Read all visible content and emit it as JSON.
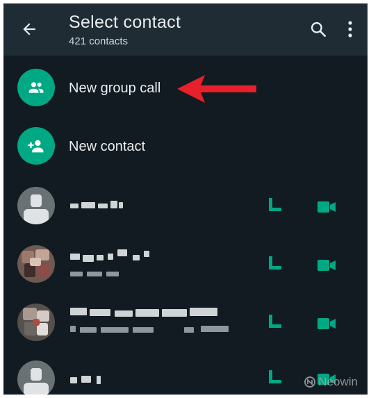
{
  "header": {
    "title": "Select contact",
    "subtitle": "421 contacts"
  },
  "actions": [
    {
      "label": "New group call",
      "icon": "group-icon"
    },
    {
      "label": "New contact",
      "icon": "add-person-icon"
    }
  ],
  "contacts": [
    {
      "label": "",
      "avatar": "default-avatar-icon"
    },
    {
      "label": "",
      "avatar": "photo"
    },
    {
      "label": "",
      "avatar": "photo"
    },
    {
      "label": "",
      "avatar": "default-avatar-icon"
    }
  ],
  "watermark": "Neowin",
  "colors": {
    "background": "#121b22",
    "header": "#1f2c34",
    "accent": "#00a884",
    "arrow": "#e8202a"
  }
}
